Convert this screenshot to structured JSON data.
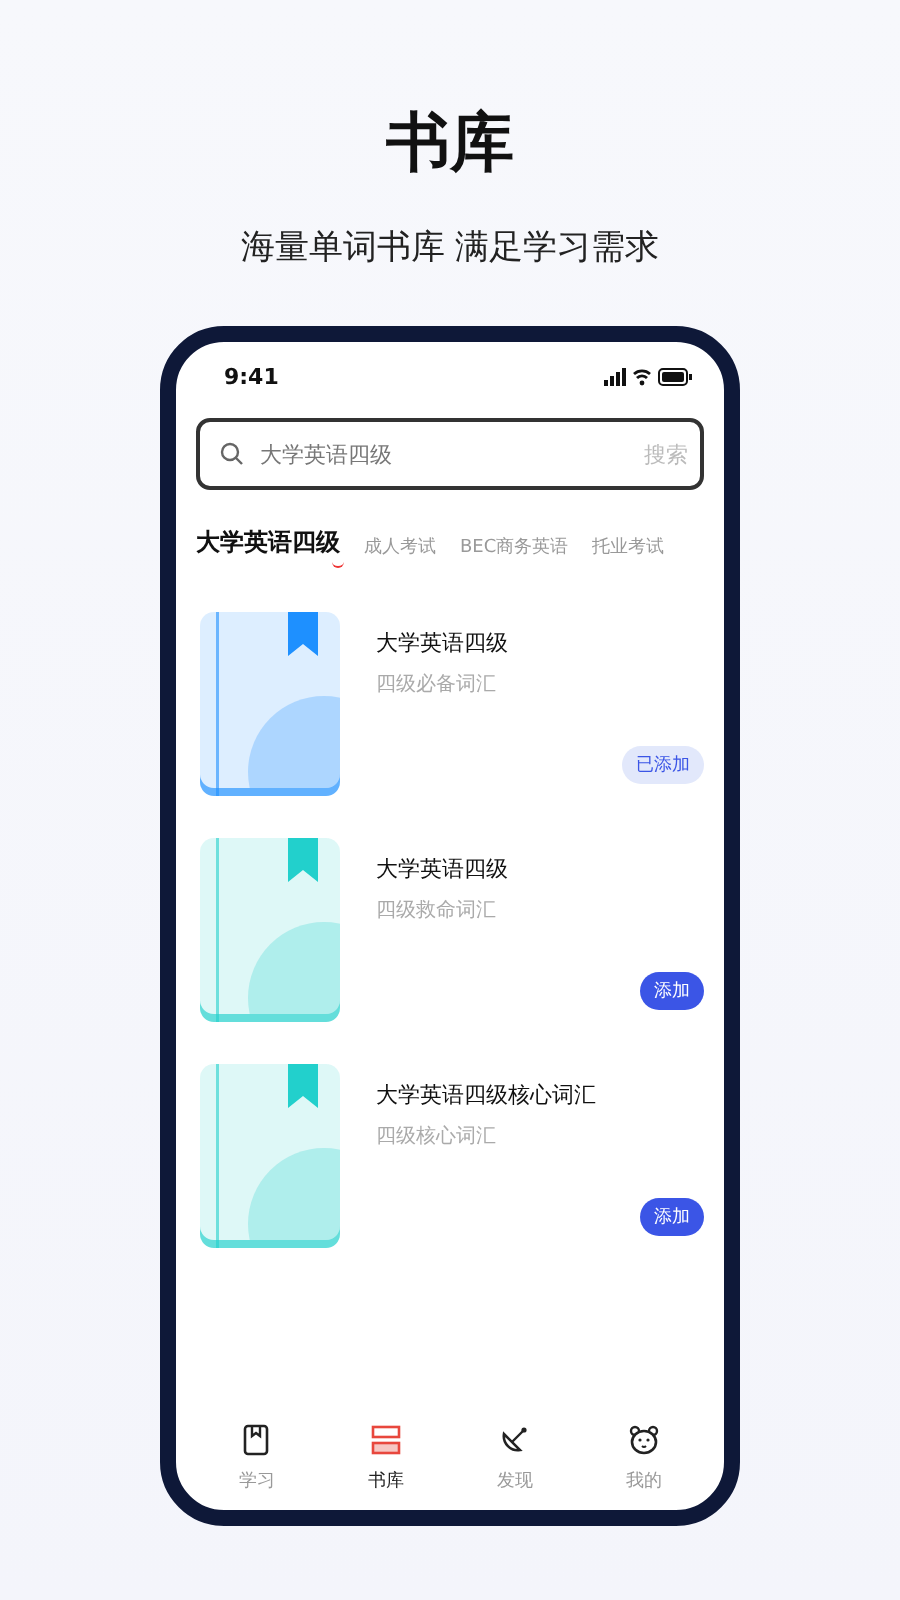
{
  "header": {
    "title": "书库",
    "subtitle": "海量单词书库 满足学习需求"
  },
  "status_bar": {
    "time": "9:41"
  },
  "search": {
    "placeholder": "大学英语四级",
    "action": "搜索"
  },
  "tabs": [
    {
      "label": "大学英语四级",
      "selected": true
    },
    {
      "label": "成人考试",
      "selected": false
    },
    {
      "label": "BEC商务英语",
      "selected": false
    },
    {
      "label": "托业考试",
      "selected": false
    }
  ],
  "books": [
    {
      "title": "大学英语四级",
      "subtitle": "四级必备词汇",
      "color": "#1e90ff",
      "added": true,
      "button": "已添加"
    },
    {
      "title": "大学英语四级",
      "subtitle": "四级救命词汇",
      "color": "#22d0cc",
      "added": false,
      "button": "添加"
    },
    {
      "title": "大学英语四级核心词汇",
      "subtitle": "四级核心词汇",
      "color": "#22d0cc",
      "added": false,
      "button": "添加"
    }
  ],
  "nav": [
    {
      "label": "学习",
      "kind": "book",
      "selected": false
    },
    {
      "label": "书库",
      "kind": "library",
      "selected": true
    },
    {
      "label": "发现",
      "kind": "dish",
      "selected": false
    },
    {
      "label": "我的",
      "kind": "bear",
      "selected": false
    }
  ]
}
